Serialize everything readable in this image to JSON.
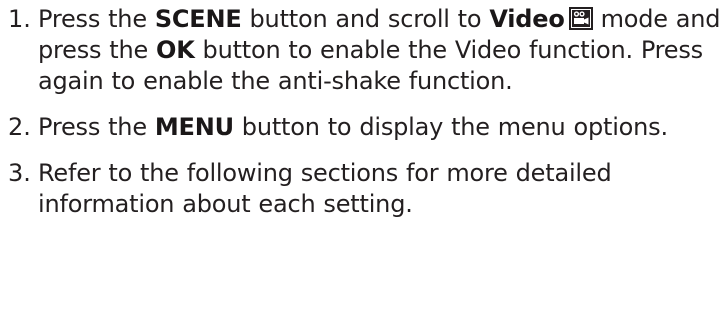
{
  "steps": [
    {
      "number": "1.",
      "parts": [
        {
          "t": "Press the "
        },
        {
          "b": "SCENE"
        },
        {
          "t": " button and scroll to "
        },
        {
          "b": "Video"
        },
        {
          "icon": "video-camera-icon"
        },
        {
          "t": " mode and press the "
        },
        {
          "b": "OK"
        },
        {
          "t": " button to enable the Video function. Press again to enable the anti-shake function."
        }
      ]
    },
    {
      "number": "2.",
      "parts": [
        {
          "t": "Press the "
        },
        {
          "b": "MENU"
        },
        {
          "t": " button to display the menu options."
        }
      ]
    },
    {
      "number": "3.",
      "parts": [
        {
          "t": "Refer to the following sections for more detailed information about each setting."
        }
      ]
    }
  ],
  "colors": {
    "text": "#231f20",
    "icon": "#231f20"
  }
}
